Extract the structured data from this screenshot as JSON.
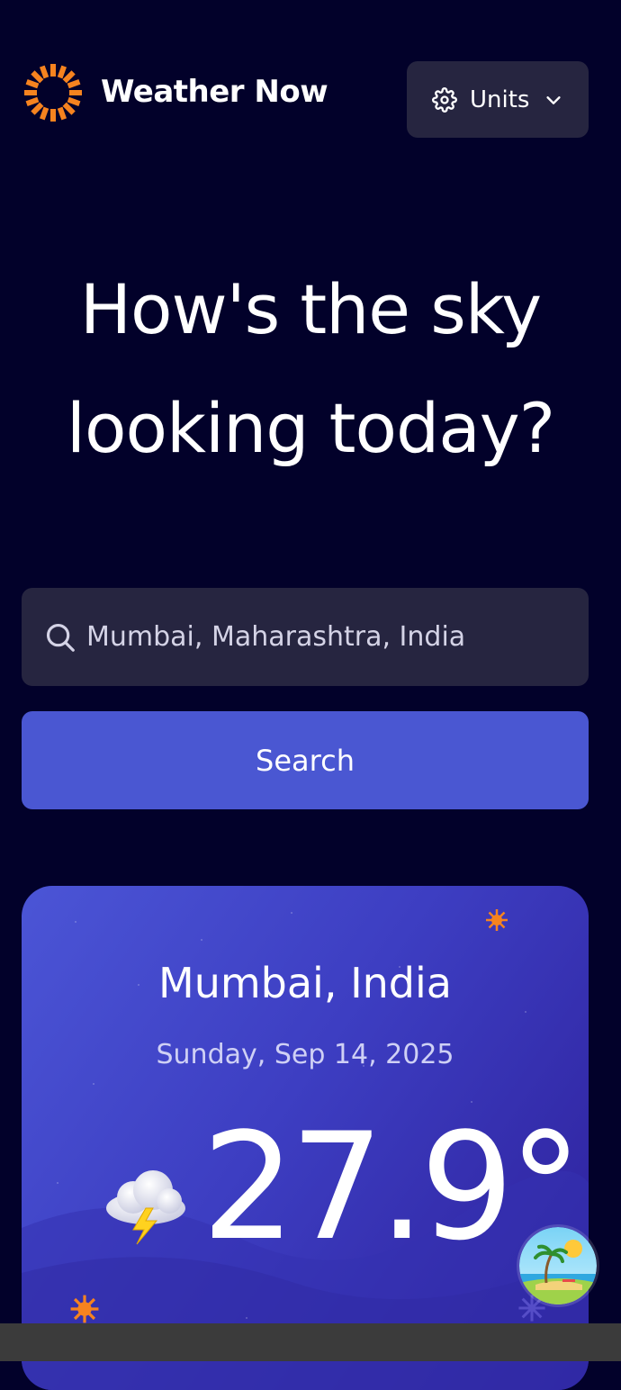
{
  "header": {
    "brand": "Weather Now",
    "units_label": "Units"
  },
  "hero": {
    "line1": "How's the sky",
    "line2": "looking today?"
  },
  "search": {
    "value": "Mumbai, Maharashtra, India",
    "button_label": "Search"
  },
  "current": {
    "location": "Mumbai, India",
    "date": "Sunday, Sep 14, 2025",
    "temperature": "27.9°",
    "condition_icon": "thunderstorm-icon"
  },
  "icons": {
    "logo": "sun-logo-icon",
    "units": "gear-icon",
    "dropdown": "chevron-down-icon",
    "search": "search-icon",
    "assistant": "beach-avatar-icon"
  },
  "colors": {
    "background": "#02012a",
    "surface": "#262540",
    "accent": "#4a57d2",
    "logo": "#f6831f"
  }
}
